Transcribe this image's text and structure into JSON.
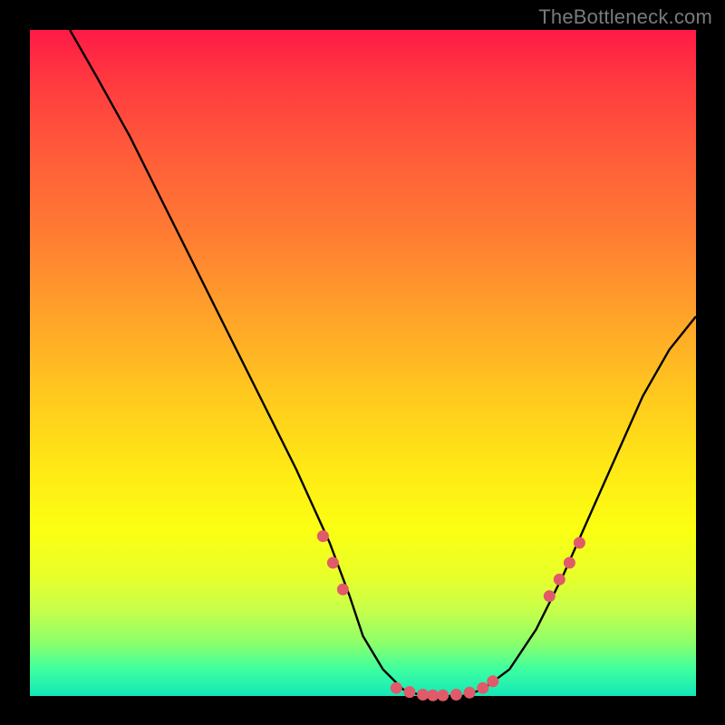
{
  "watermark": "TheBottleneck.com",
  "colors": {
    "background": "#000000",
    "curve": "#000000",
    "markers": "#e05a69",
    "watermark_text": "#7a7a7a"
  },
  "chart_data": {
    "type": "line",
    "title": "",
    "xlabel": "",
    "ylabel": "",
    "xlim": [
      0,
      100
    ],
    "ylim": [
      0,
      100
    ],
    "grid": false,
    "legend": false,
    "series": [
      {
        "name": "bottleneck-curve",
        "x": [
          6,
          10,
          15,
          20,
          25,
          30,
          35,
          40,
          45,
          48,
          50,
          53,
          56,
          59,
          62,
          65,
          68,
          72,
          76,
          80,
          84,
          88,
          92,
          96,
          100
        ],
        "y": [
          100,
          93,
          84,
          74,
          64,
          54,
          44,
          34,
          23,
          15,
          9,
          4,
          1,
          0,
          0,
          0,
          1,
          4,
          10,
          18,
          27,
          36,
          45,
          52,
          57
        ]
      }
    ],
    "markers": {
      "name": "highlight-points",
      "x": [
        44,
        45.5,
        47,
        55,
        57,
        59,
        60.5,
        62,
        64,
        66,
        68,
        69.5,
        78,
        79.5,
        81,
        82.5
      ],
      "y": [
        24,
        20,
        16,
        1.2,
        0.6,
        0.2,
        0.1,
        0.1,
        0.2,
        0.5,
        1.2,
        2.2,
        15,
        17.5,
        20,
        23
      ]
    }
  }
}
